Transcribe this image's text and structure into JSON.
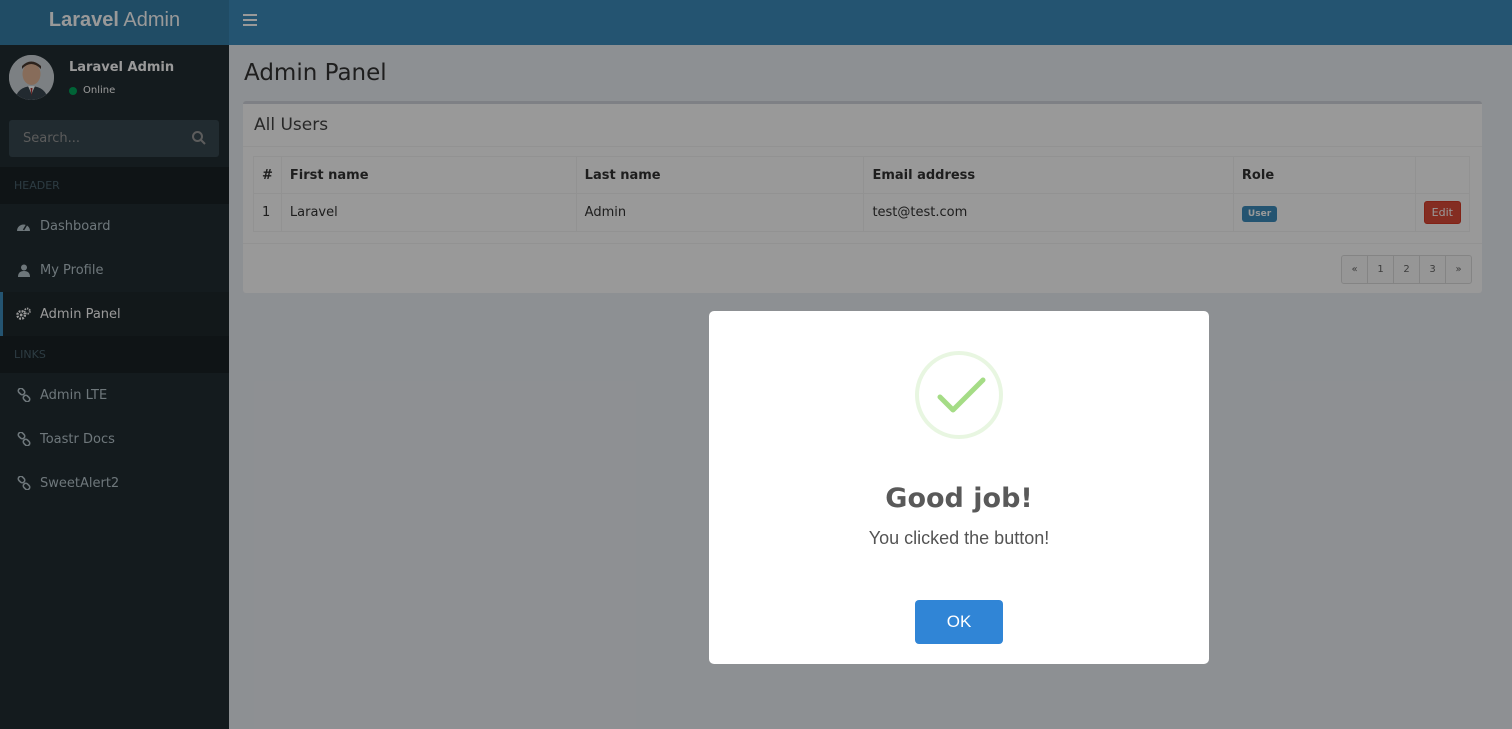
{
  "app": {
    "logo_bold": "Laravel",
    "logo_light": "Admin"
  },
  "user": {
    "name": "Laravel Admin",
    "status": "Online"
  },
  "search": {
    "placeholder": "Search..."
  },
  "sidebar": {
    "header_label": "HEADER",
    "links_label": "LINKS",
    "items": [
      {
        "label": "Dashboard",
        "icon": "dashboard-icon"
      },
      {
        "label": "My Profile",
        "icon": "user-icon"
      },
      {
        "label": "Admin Panel",
        "icon": "gears-icon",
        "active": true
      }
    ],
    "links": [
      {
        "label": "Admin LTE",
        "icon": "link-icon"
      },
      {
        "label": "Toastr Docs",
        "icon": "link-icon"
      },
      {
        "label": "SweetAlert2",
        "icon": "link-icon"
      }
    ]
  },
  "main": {
    "page_title": "Admin Panel",
    "box_title": "All Users",
    "table": {
      "headers": [
        "#",
        "First name",
        "Last name",
        "Email address",
        "Role",
        ""
      ],
      "rows": [
        {
          "id": "1",
          "first": "Laravel",
          "last": "Admin",
          "email": "test@test.com",
          "role": "User",
          "action": "Edit"
        }
      ]
    },
    "pagination": [
      "«",
      "1",
      "2",
      "3",
      "»"
    ]
  },
  "modal": {
    "title": "Good job!",
    "text": "You clicked the button!",
    "ok_label": "OK",
    "icon": "success-check-icon"
  },
  "colors": {
    "navbar": "#3c8dbc",
    "logo": "#367fa9",
    "sidebar": "#222d32",
    "ok_button": "#3085d6",
    "edit_button": "#dd4b39",
    "success": "#a5dc86"
  }
}
